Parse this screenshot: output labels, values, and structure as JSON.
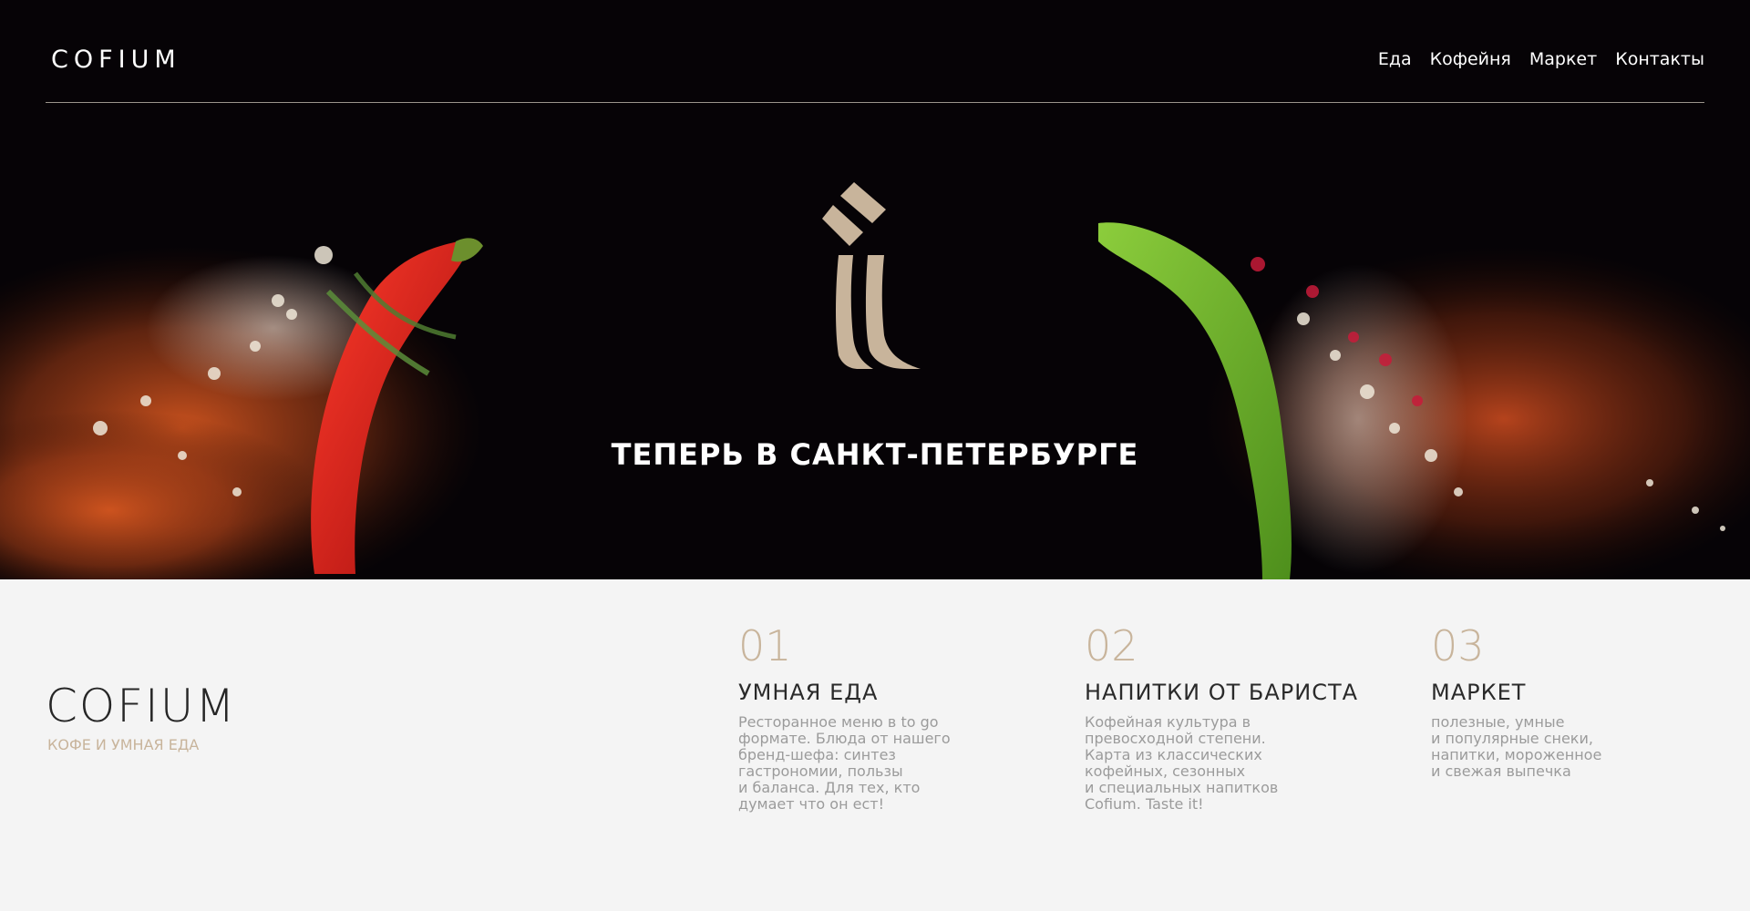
{
  "header": {
    "logo": "COFIUM",
    "nav": [
      "Еда",
      "Кофейня",
      "Маркет",
      "Контакты"
    ]
  },
  "hero": {
    "title": "ТЕПЕРЬ В САНКТ-ПЕТЕРБУРГЕ",
    "emblem_icon": "cofium-emblem-icon",
    "background": "black background with exploding spices, red pepper on the left, green pepper on the right"
  },
  "about": {
    "brand": "COFIUM",
    "tagline": "КОФЕ И УМНАЯ ЕДА"
  },
  "features": [
    {
      "number": "01",
      "title": "УМНАЯ ЕДА",
      "text": "Ресторанное меню в to go\nформате. Блюда от нашего\nбренд-шефа: синтез\nгастрономии, пользы\nи баланса. Для тех, кто\nдумает что он ест!"
    },
    {
      "number": "02",
      "title": "НАПИТКИ ОТ БАРИСТА",
      "text": "Кофейная культура в\nпревосходной степени.\nКарта из классических\nкофейных, сезонных\nи специальных напитков\nCofium. Taste it!"
    },
    {
      "number": "03",
      "title": "МАРКЕТ",
      "text": "полезные, умные\nи популярные снеки,\nнапитки, мороженное\nи свежая выпечка"
    }
  ],
  "colors": {
    "accent": "#c8b49b",
    "hero_bg": "#060306",
    "section_bg": "#f4f4f4"
  }
}
